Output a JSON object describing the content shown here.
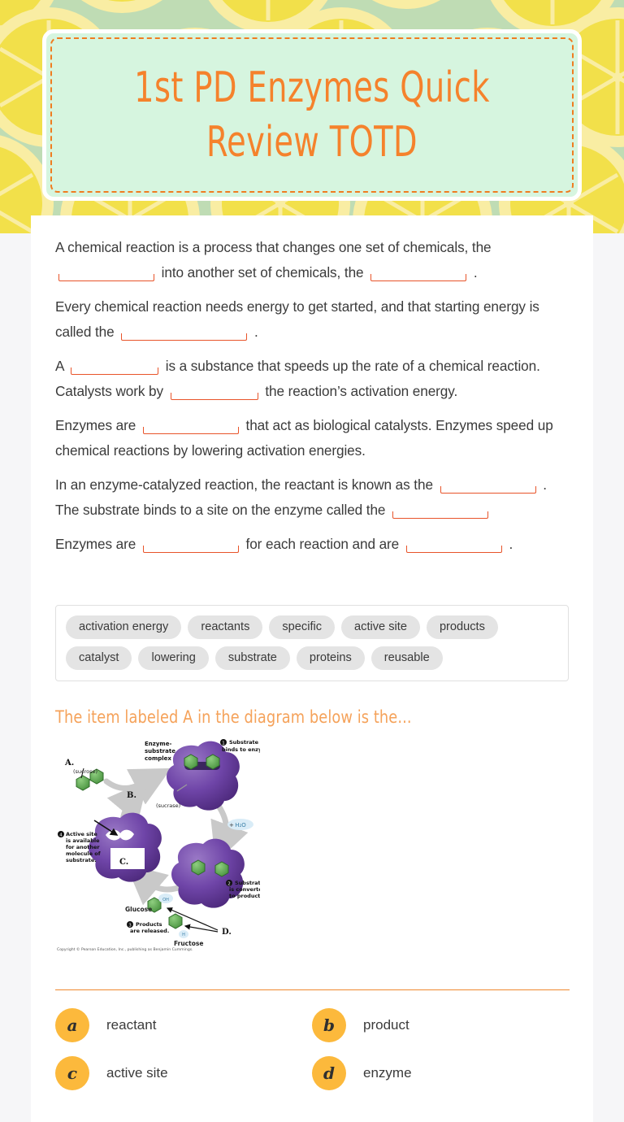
{
  "title": {
    "text": "1st PD Enzymes Quick Review TOTD",
    "card_bg": "#d6f5df",
    "text_color": "#f5822c",
    "dash_color": "#f07c20"
  },
  "background": {
    "pattern": "lemon-slices",
    "base_color": "#bfdcb4",
    "lemon_color": "#f2e04a",
    "lemon_rind_color": "#f9eda3"
  },
  "worksheet": {
    "paragraphs": [
      {
        "id": "p1",
        "segments": [
          {
            "type": "text",
            "value": "A chemical reaction is a process that changes one set of chemicals, the"
          },
          {
            "type": "blank",
            "size": "w-md"
          },
          {
            "type": "text",
            "value": "into another set of chemicals, the"
          },
          {
            "type": "blank",
            "size": "w-md"
          },
          {
            "type": "text",
            "value": "."
          }
        ]
      },
      {
        "id": "p2",
        "segments": [
          {
            "type": "text",
            "value": "Every chemical reaction needs energy to get started, and that starting energy is called the"
          },
          {
            "type": "blank",
            "size": "w-lg"
          },
          {
            "type": "text",
            "value": "."
          }
        ]
      },
      {
        "id": "p3",
        "segments": [
          {
            "type": "text",
            "value": "A"
          },
          {
            "type": "blank",
            "size": "w-sm"
          },
          {
            "type": "text",
            "value": "is a substance that speeds up the rate of a chemical reaction. Catalysts work by"
          },
          {
            "type": "blank",
            "size": "w-sm"
          },
          {
            "type": "text",
            "value": "the reaction’s activation energy."
          }
        ]
      },
      {
        "id": "p4",
        "segments": [
          {
            "type": "text",
            "value": "Enzymes are"
          },
          {
            "type": "blank",
            "size": "w-md"
          },
          {
            "type": "text",
            "value": "that act as biological catalysts. Enzymes speed up chemical reactions by lowering activation energies."
          }
        ]
      },
      {
        "id": "p5",
        "segments": [
          {
            "type": "text",
            "value": "In an enzyme-catalyzed reaction, the reactant is known as the"
          },
          {
            "type": "blank",
            "size": "w-md"
          },
          {
            "type": "text",
            "value": ". The substrate binds to a site on the enzyme called the"
          },
          {
            "type": "blank",
            "size": "w-md"
          },
          {
            "type": "text",
            "value": ""
          }
        ]
      },
      {
        "id": "p6",
        "segments": [
          {
            "type": "text",
            "value": "Enzymes are"
          },
          {
            "type": "blank",
            "size": "w-md"
          },
          {
            "type": "text",
            "value": "for each reaction and are"
          },
          {
            "type": "blank",
            "size": "w-md"
          },
          {
            "type": "text",
            "value": "."
          }
        ]
      }
    ],
    "word_bank": [
      "activation energy",
      "reactants",
      "specific",
      "active site",
      "products",
      "catalyst",
      "lowering",
      "substrate",
      "proteins",
      "reusable"
    ]
  },
  "question": {
    "prompt": "The item labeled A in the diagram below is the...",
    "options": [
      {
        "letter": "a",
        "label": "reactant"
      },
      {
        "letter": "b",
        "label": "product"
      },
      {
        "letter": "c",
        "label": "active site"
      },
      {
        "letter": "d",
        "label": "enzyme"
      }
    ],
    "bubble_color": "#fcb93c",
    "divider_color": "#f0892e"
  },
  "diagram": {
    "alt": "Enzyme-catalyzed sucrose hydrolysis cycle diagram",
    "labels": {
      "a": "A.",
      "b": "B.",
      "c": "C.",
      "d": "D.",
      "sucrose": "(sucrose)",
      "sucrase": "(sucrase)",
      "complex_line1": "Enzyme-",
      "complex_line2": "substrate",
      "complex_line3": "complex",
      "glucose": "Glucose",
      "fructose": "Fructose",
      "water": "+ H₂O"
    },
    "steps": [
      {
        "num": "1",
        "line1": "Substrate",
        "line2": "binds to enzyme."
      },
      {
        "num": "2",
        "line1": "Substrate",
        "line2": "is converted",
        "line3": "to products."
      },
      {
        "num": "3",
        "line1": "Products",
        "line2": "are released."
      },
      {
        "num": "4",
        "line1": "Active site",
        "line2": "is available",
        "line3": "for another",
        "line4": "molecule of",
        "line5": "substrate."
      }
    ],
    "copyright": "Copyright © Pearson Education, Inc., publishing as Benjamin Cummings.",
    "colors": {
      "enzyme": "#6b3fa0",
      "substrate": "#5aa84f",
      "arrow": "#c9c9c9"
    }
  }
}
